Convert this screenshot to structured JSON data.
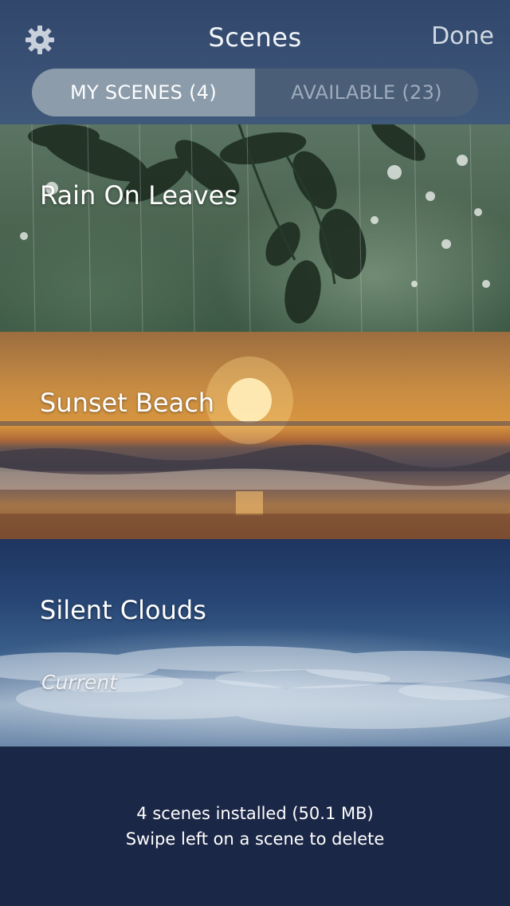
{
  "header": {
    "title": "Scenes",
    "done_label": "Done",
    "settings_icon": "gear-icon"
  },
  "tabs": [
    {
      "label": "MY SCENES (4)",
      "active": true
    },
    {
      "label": "AVAILABLE (23)",
      "active": false
    }
  ],
  "scenes": [
    {
      "title": "Rain On Leaves",
      "subtitle": ""
    },
    {
      "title": "Sunset Beach",
      "subtitle": ""
    },
    {
      "title": "Silent Clouds",
      "subtitle": "Current"
    }
  ],
  "footer": {
    "line1": "4 scenes installed (50.1 MB)",
    "line2": "Swipe left on a scene to delete"
  },
  "colors": {
    "header_bg": "#3a5275",
    "active_tab": "#8d9cab",
    "inactive_tab": "#4a5e78",
    "footer_bg": "#1b2746"
  }
}
